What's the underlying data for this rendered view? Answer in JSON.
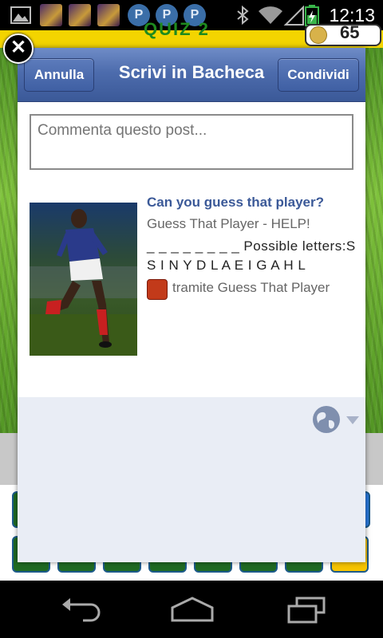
{
  "status_bar": {
    "time": "12:13",
    "notification_icons": [
      "picture-icon",
      "game-avatar-icon",
      "game-avatar-icon",
      "game-avatar-icon",
      "p-app-icon",
      "p-app-icon",
      "p-app-icon"
    ],
    "p_label": "P",
    "battery_level": 0.6
  },
  "background_game": {
    "title": "QUIZ 2",
    "coins": "65"
  },
  "dialog": {
    "title": "Scrivi in Bacheca",
    "cancel_label": "Annulla",
    "share_label": "Condividi",
    "comment_placeholder": "Commenta questo post...",
    "comment_value": "",
    "link": {
      "title": "Can you guess that player?",
      "subtitle": "Guess That Player - HELP!",
      "description": "_ _ _ _ _ _ _ _ Possible letters:S S I N Y D L A E I G A H L",
      "via": "tramite Guess That Player"
    },
    "privacy_icon": "globe-icon"
  },
  "colors": {
    "header_blue": "#3b5998",
    "link_blue": "#3b5998",
    "dialog_bg": "#e9edf5"
  }
}
